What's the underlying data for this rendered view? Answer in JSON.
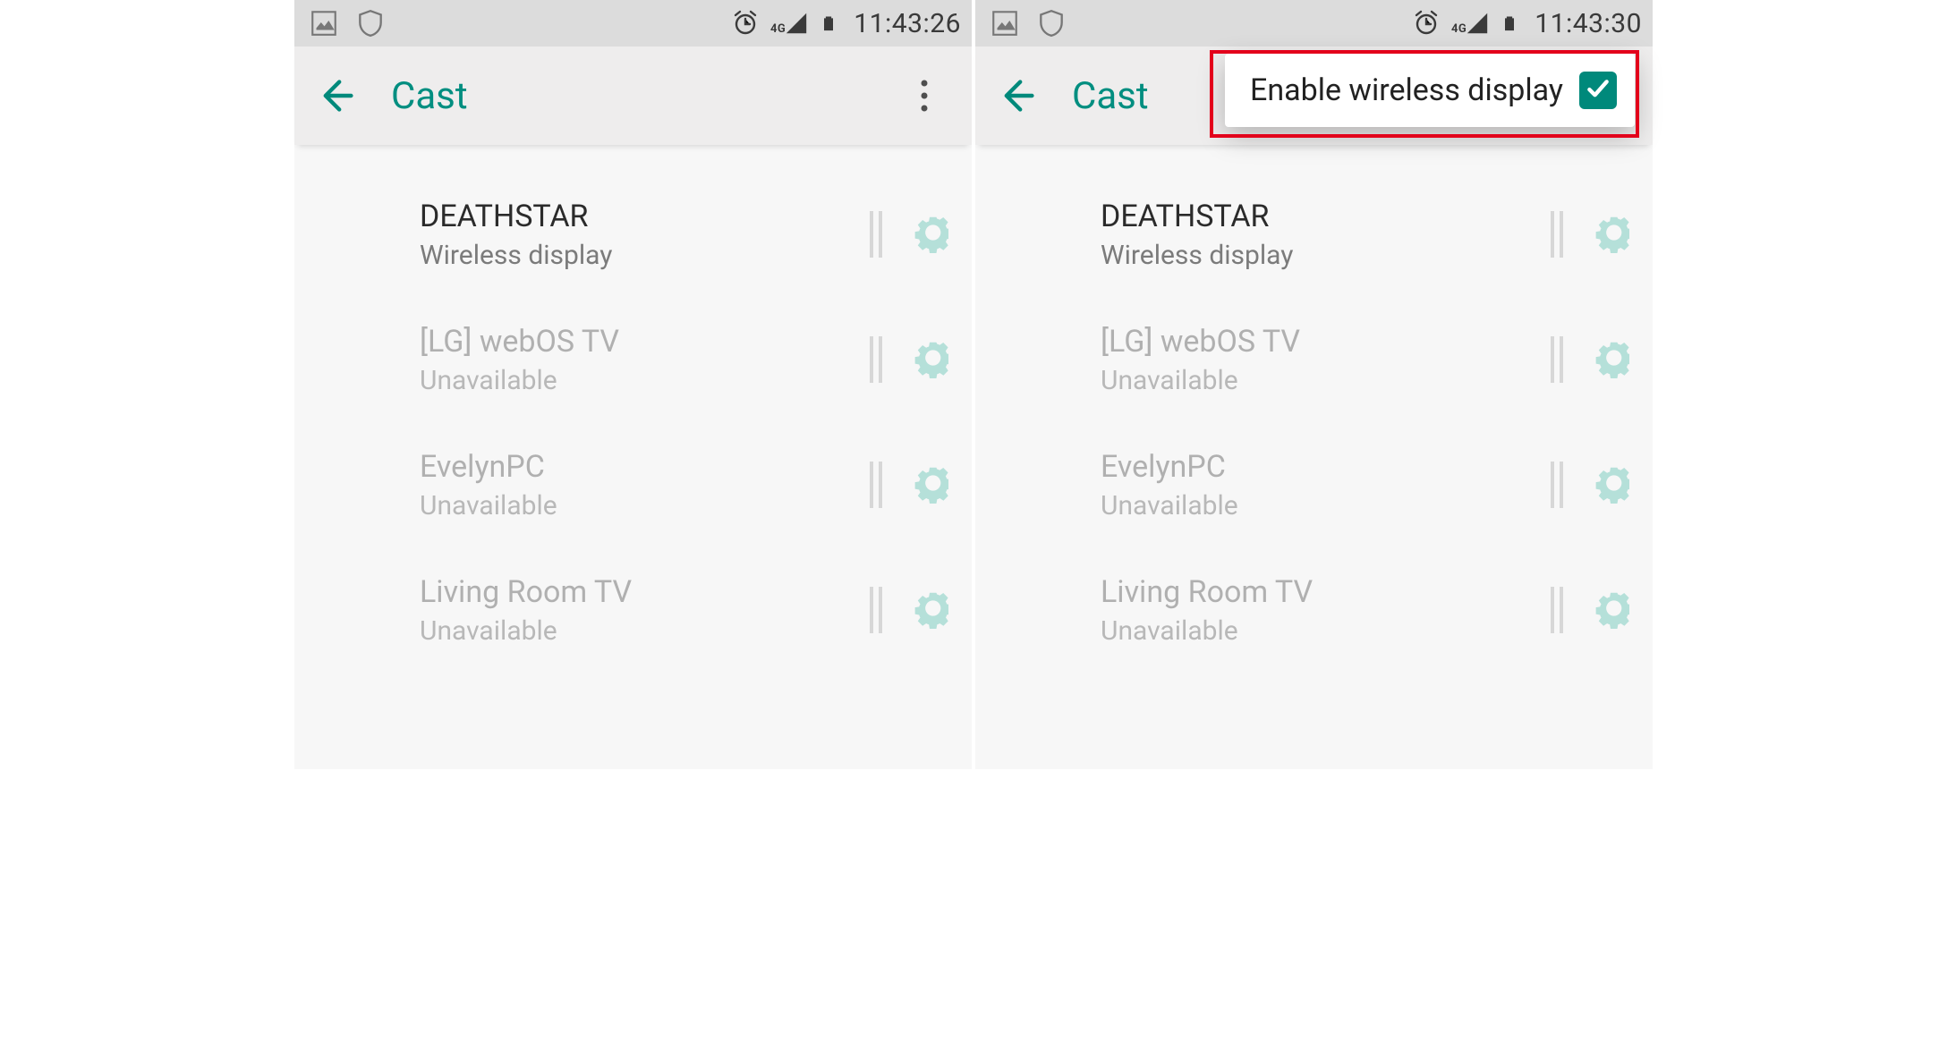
{
  "colors": {
    "accent": "#008e80",
    "highlight": "#e3001b"
  },
  "left": {
    "status": {
      "network": "4G",
      "time": "11:43:26"
    },
    "title": "Cast"
  },
  "right": {
    "status": {
      "network": "4G",
      "time": "11:43:30"
    },
    "title": "Cast",
    "popup": {
      "label": "Enable wireless display",
      "checked": true
    }
  },
  "devices": [
    {
      "name": "DEATHSTAR",
      "subtitle": "Wireless display",
      "available": true
    },
    {
      "name": "[LG] webOS TV",
      "subtitle": "Unavailable",
      "available": false
    },
    {
      "name": "EvelynPC",
      "subtitle": "Unavailable",
      "available": false
    },
    {
      "name": "Living Room TV",
      "subtitle": "Unavailable",
      "available": false
    }
  ]
}
